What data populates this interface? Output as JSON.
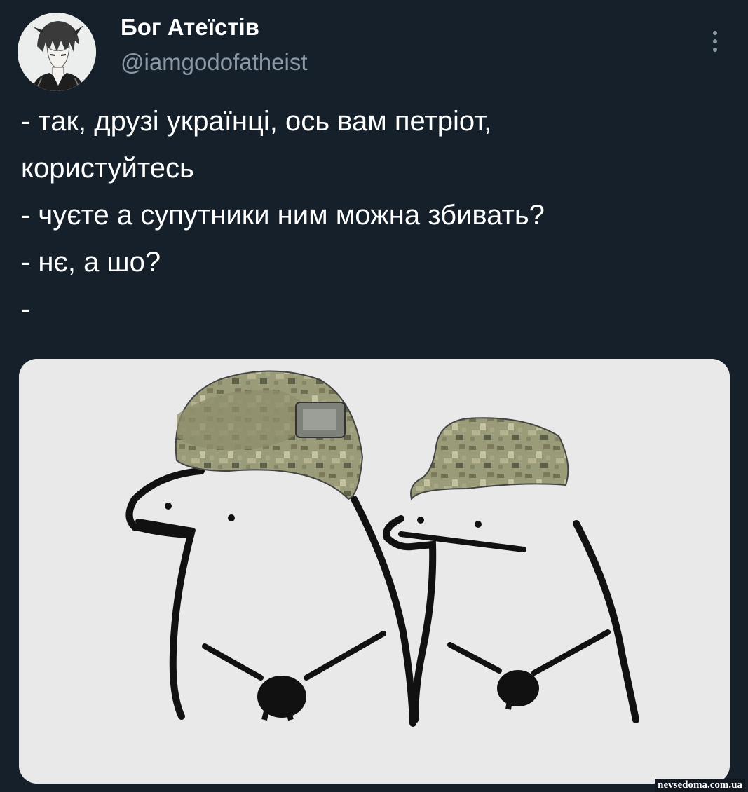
{
  "author": {
    "display_name": "Бог Атеїстів",
    "handle": "@iamgodofatheist",
    "avatar_icon": "anime-character-avatar"
  },
  "tweet": {
    "lines": [
      "- так, друзі українці, ось вам петріот,",
      "користуйтесь",
      "- чуєте а супутники ним можна збивать?",
      "- нє, а шо?",
      "-"
    ]
  },
  "media": {
    "description_icon": "meme-two-characters-in-military-caps"
  },
  "more_icon": "more-options-icon",
  "watermark": "nevsedoma.com.ua",
  "colors": {
    "background": "#15202b",
    "text_primary": "#ffffff",
    "text_secondary": "#8b98a5",
    "media_background": "#e9e9e9"
  }
}
